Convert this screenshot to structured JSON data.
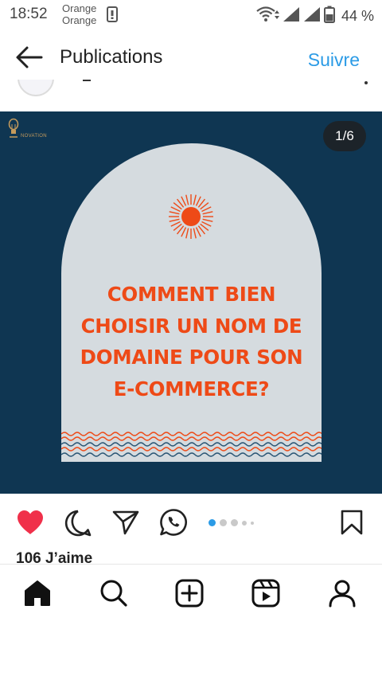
{
  "status_bar": {
    "time": "18:52",
    "carrier_line1": "Orange",
    "carrier_line2": "Orange",
    "battery": "44 %",
    "icons": [
      "sim-icon",
      "wifi-icon",
      "signal-icon",
      "signal-icon",
      "battery-icon"
    ]
  },
  "header": {
    "title": "Publications",
    "follow_label": "Suivre",
    "back_icon": "arrow-left-icon"
  },
  "post": {
    "slide_counter": "1/6",
    "brand": "NOVATION",
    "headline_lines": [
      "COMMENT BIEN",
      "CHOISIR UN NOM DE",
      "DOMAINE POUR SON",
      "E-COMMERCE?"
    ],
    "colors": {
      "background": "#0f3652",
      "arch": "#d5dbdf",
      "accent": "#ee4a17"
    }
  },
  "actions": {
    "icons": [
      "heart-icon",
      "comment-icon",
      "share-icon",
      "whatsapp-icon",
      "bookmark-icon"
    ],
    "liked": true,
    "carousel_dots": 5,
    "active_dot": 1
  },
  "likes_text": "106 J’aime",
  "bottom_nav": {
    "items": [
      "home-icon",
      "search-icon",
      "add-icon",
      "reels-icon",
      "profile-icon"
    ],
    "active": "home-icon"
  },
  "theme": {
    "link_color": "#2b9be6",
    "like_color": "#f0304a"
  }
}
